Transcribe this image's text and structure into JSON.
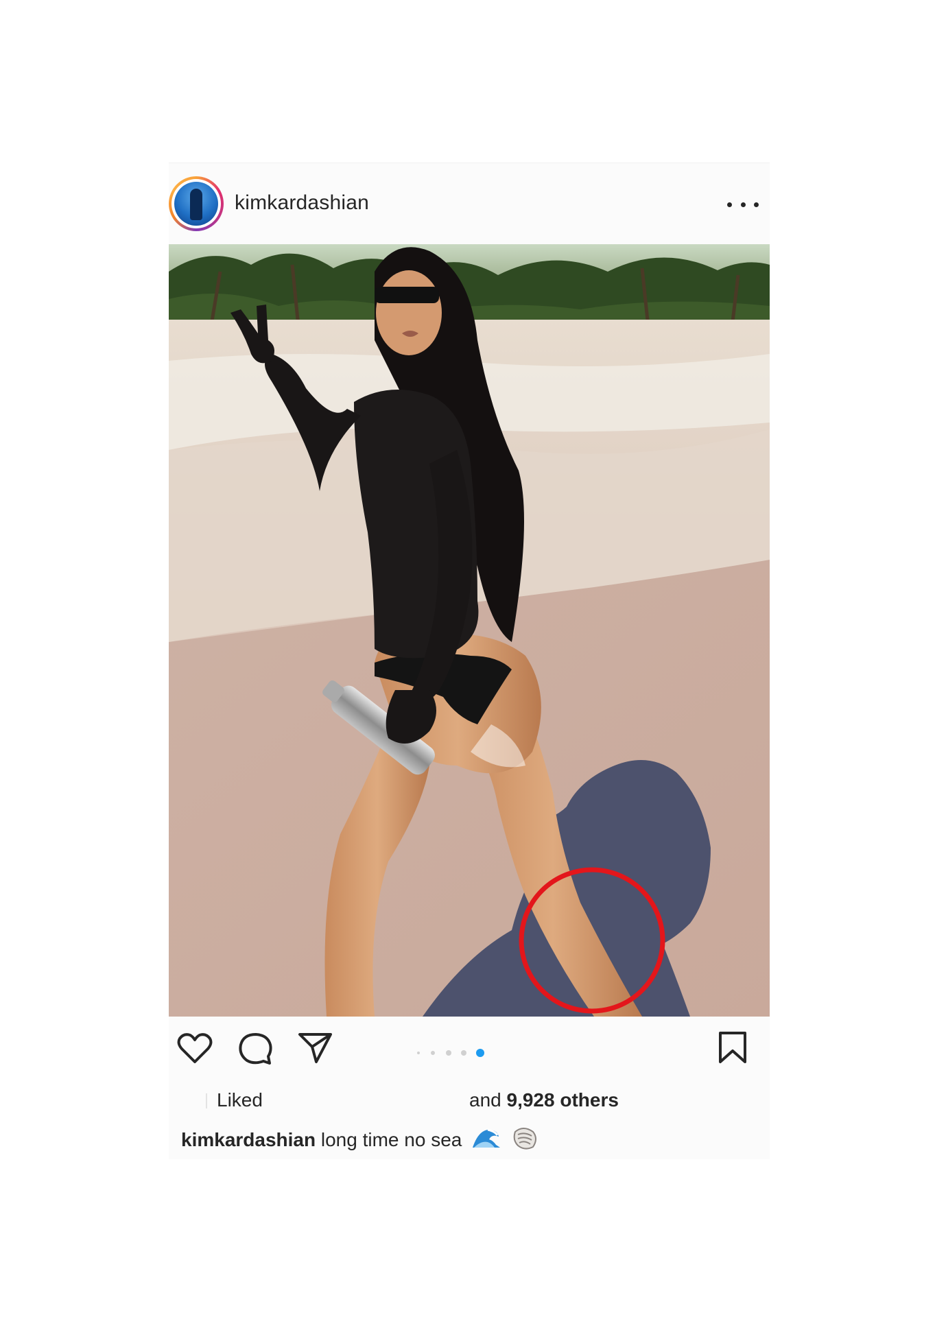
{
  "post": {
    "username": "kimkardashian",
    "more_icon": "more-dots-icon",
    "carousel": {
      "count": 5,
      "active_index": 4
    },
    "likes": {
      "liked_label": "Liked",
      "and_text": "and",
      "count_text": "9,928 others"
    },
    "caption": {
      "author": "kimkardashian",
      "text": "long time no sea",
      "emojis": [
        "wave-emoji",
        "shell-emoji"
      ]
    },
    "colors": {
      "highlight_circle": "#e3161b",
      "active_dot": "#1d9bf0",
      "inactive_dot": "#d0d0d0"
    }
  }
}
